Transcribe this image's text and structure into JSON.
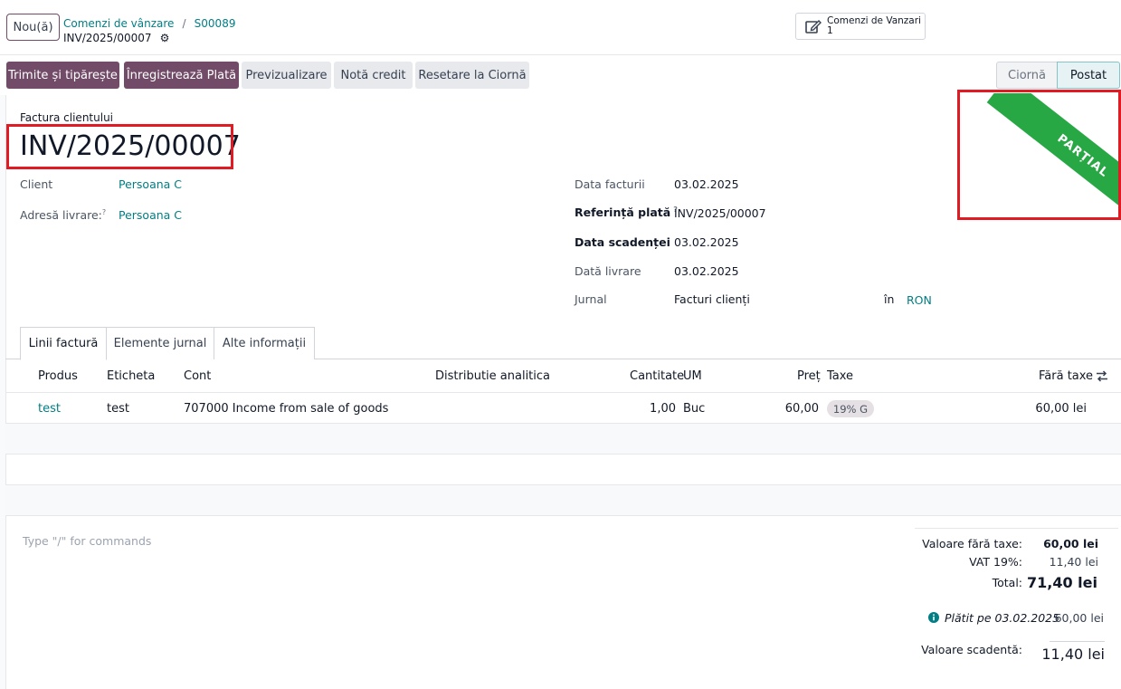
{
  "header": {
    "new_button": "Nou(ă)",
    "breadcrumb_parent": "Comenzi de vânzare",
    "breadcrumb_sep": "/",
    "breadcrumb_order": "S00089",
    "current_record": "INV/2025/00007",
    "smart_button": {
      "label": "Comenzi de Vanzari",
      "count": "1",
      "icon": "pencil-square-icon"
    }
  },
  "actions": {
    "send_print": "Trimite și tipărește",
    "register_payment": "Înregistrează Plată",
    "preview": "Previzualizare",
    "credit_note": "Notă credit",
    "reset_draft": "Resetare la Ciornă"
  },
  "status": {
    "draft": "Ciornă",
    "posted": "Postat",
    "active": "Postat"
  },
  "ribbon": {
    "text": "PARȚIAL",
    "color": "#28a745"
  },
  "document": {
    "type_label": "Factura clientului",
    "title": "INV/2025/00007"
  },
  "fields_left": {
    "client_label": "Client",
    "client_value": "Persoana C",
    "delivery_label": "Adresă livrare:",
    "delivery_value": "Persoana C",
    "help_mark": "?"
  },
  "fields_right": {
    "invoice_date_label": "Data facturii",
    "invoice_date": "03.02.2025",
    "payment_ref_label": "Referință plată",
    "payment_ref": "INV/2025/00007",
    "due_date_label": "Data scadenței",
    "due_date": "03.02.2025",
    "delivery_date_label": "Dată livrare",
    "delivery_date": "03.02.2025",
    "journal_label": "Jurnal",
    "journal": "Facturi clienți",
    "in_label": "în",
    "currency": "RON"
  },
  "tabs": [
    "Linii factură",
    "Elemente jurnal",
    "Alte informații"
  ],
  "table": {
    "headers": {
      "product": "Produs",
      "label": "Eticheta",
      "account": "Cont",
      "analytic": "Distributie analitica",
      "qty": "Cantitate",
      "uom": "UM",
      "price": "Preț",
      "taxes": "Taxe",
      "subtotal": "Fără taxe"
    },
    "rows": [
      {
        "product": "test",
        "label": "test",
        "account": "707000 Income from sale of goods",
        "qty": "1,00",
        "uom": "Buc",
        "price": "60,00",
        "tax": "19% G",
        "subtotal": "60,00 lei"
      }
    ]
  },
  "notes_placeholder": "Type \"/\" for commands",
  "totals": {
    "untaxed_label": "Valoare fără taxe:",
    "untaxed": "60,00 lei",
    "vat_label": "VAT 19%:",
    "vat": "11,40 lei",
    "total_label": "Total:",
    "total": "71,40 lei",
    "paid_label": "Plătit pe 03.02.2025",
    "paid": "60,00 lei",
    "due_label": "Valoare scadentă:",
    "due": "11,40 lei"
  }
}
